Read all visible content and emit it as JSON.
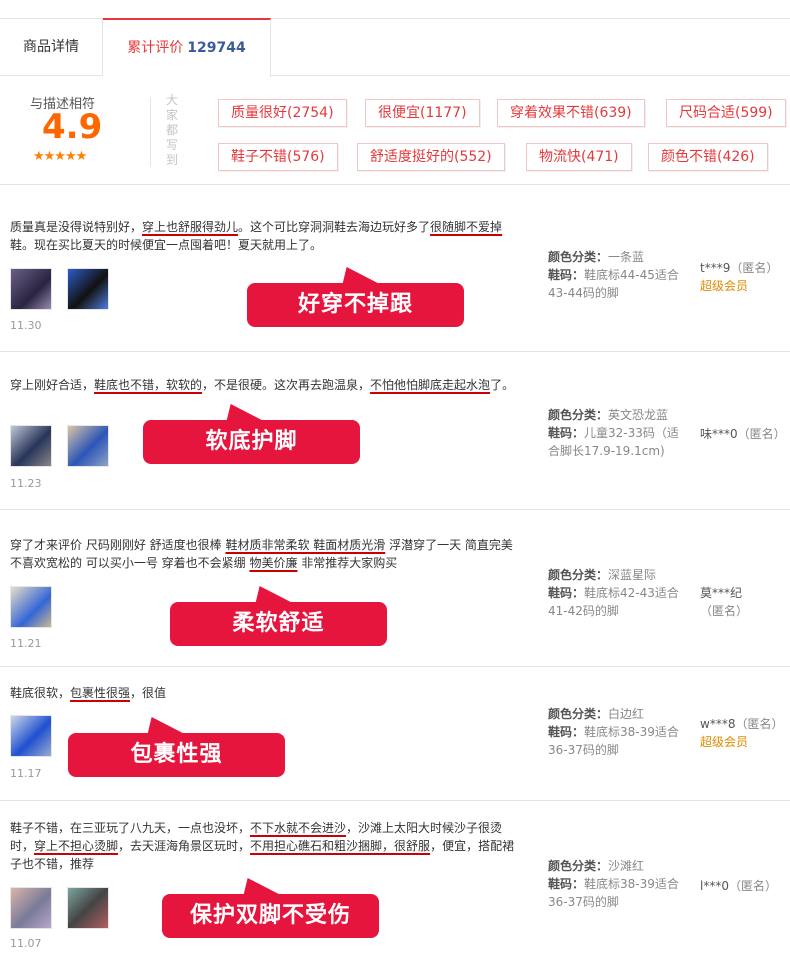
{
  "tabs": {
    "detail": "商品详情",
    "reviews": "累计评价",
    "review_count": "129744"
  },
  "summary": {
    "score_label": "与描述相符",
    "score": "4.9",
    "stars": "★★★★★",
    "side_label": "大家都写到",
    "tags": [
      "质量很好(2754)",
      "很便宜(1177)",
      "穿着效果不错(639)",
      "尺码合适(599)",
      "鞋子不错(576)",
      "舒适度挺好的(552)",
      "物流快(471)",
      "颜色不错(426)"
    ]
  },
  "reviews": [
    {
      "text_parts": [
        "质量真是没得说特别好，",
        "穿上也舒服得劲儿",
        "。这个可比穿洞洞鞋去海边玩好多了",
        "很随脚不爱掉",
        "鞋。现在买比夏天的时候便宜一点囤着吧！夏天就用上了。"
      ],
      "date": "11.30",
      "color_label": "颜色分类：",
      "color": "一条蓝",
      "size_label": "鞋码：",
      "size": "鞋底标44-45适合43-44码的脚",
      "user": "t***9",
      "anon": "（匿名）",
      "member": "超级会员",
      "callout": "好穿不掉跟"
    },
    {
      "text_parts": [
        "穿上刚好合适，",
        "鞋底也不错，软软的",
        "，不是很硬。这次再去跑温泉，",
        "不怕他怕脚底走起水泡",
        "了。"
      ],
      "date": "11.23",
      "color_label": "颜色分类：",
      "color": "英文恐龙蓝",
      "size_label": "鞋码：",
      "size": "儿童32-33码（适合脚长17.9-19.1cm)",
      "user": "味***0",
      "anon": "（匿名）",
      "member": "",
      "callout": "软底护脚"
    },
    {
      "text_parts": [
        "穿了才来评价 尺码刚刚好 舒适度也很棒 ",
        "鞋材质非常柔软 鞋面材质光滑",
        "  浮潜穿了一天 简直完美 不喜欢宽松的 可以买小一号 穿着也不会紧绷 ",
        "物美价廉",
        "  非常推荐大家购买"
      ],
      "date": "11.21",
      "color_label": "颜色分类：",
      "color": "深蓝星际",
      "size_label": "鞋码：",
      "size": "鞋底标42-43适合41-42码的脚",
      "user": "莫***纪",
      "anon": "（匿名）",
      "member": "",
      "callout": "柔软舒适"
    },
    {
      "text_parts": [
        "鞋底很软，",
        "包裹性很强",
        "，很值",
        "",
        ""
      ],
      "date": "11.17",
      "color_label": "颜色分类：",
      "color": "白边红",
      "size_label": "鞋码：",
      "size": "鞋底标38-39适合36-37码的脚",
      "user": "w***8",
      "anon": "（匿名）",
      "member": "超级会员",
      "callout": "包裹性强"
    },
    {
      "text_parts": [
        "鞋子不错，在三亚玩了八九天，一点也没坏，",
        "不下水就不会进沙",
        "，沙滩上太阳大时候沙子很烫时，",
        "穿上不担心烫脚",
        "，去天涯海角景区玩时，",
        "不用担心礁石和粗沙捆脚，很舒服",
        "，便宜，搭配裙子也不错，推荐"
      ],
      "date": "11.07",
      "color_label": "颜色分类：",
      "color": "沙滩红",
      "size_label": "鞋码：",
      "size": "鞋底标38-39适合36-37码的脚",
      "user": "l***0",
      "anon": "（匿名）",
      "member": "",
      "callout": "保护双脚不受伤"
    }
  ]
}
